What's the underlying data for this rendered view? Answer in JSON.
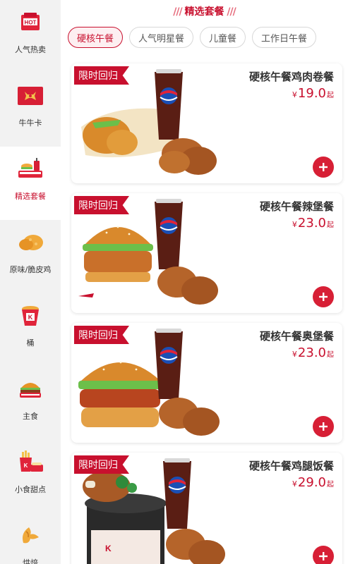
{
  "sidebar": {
    "items": [
      {
        "label": "人气热卖",
        "icon": "hot-box-icon"
      },
      {
        "label": "牛牛卡",
        "icon": "bull-card-icon"
      },
      {
        "label": "精选套餐",
        "icon": "combo-meal-icon"
      },
      {
        "label": "原味/脆皮鸡",
        "icon": "fried-chicken-icon"
      },
      {
        "label": "桶",
        "icon": "kfc-bucket-icon"
      },
      {
        "label": "主食",
        "icon": "burger-icon"
      },
      {
        "label": "小食甜点",
        "icon": "snack-fries-icon"
      },
      {
        "label": "烘焙",
        "icon": "croissant-icon"
      }
    ],
    "active_index": 2
  },
  "main": {
    "section_title": "精选套餐",
    "tabs": [
      {
        "label": "硬核午餐",
        "active": true
      },
      {
        "label": "人气明星餐",
        "active": false
      },
      {
        "label": "儿童餐",
        "active": false
      },
      {
        "label": "工作日午餐",
        "active": false
      }
    ],
    "products": [
      {
        "tag": "限时回归",
        "name": "硬核午餐鸡肉卷餐",
        "currency": "¥",
        "price": "19.0",
        "suffix": "起",
        "image": "wrap-wings-pepsi"
      },
      {
        "tag": "限时回归",
        "name": "硬核午餐辣堡餐",
        "currency": "¥",
        "price": "23.0",
        "suffix": "起",
        "image": "spicy-burger-wings-pepsi"
      },
      {
        "tag": "限时回归",
        "name": "硬核午餐奥堡餐",
        "currency": "¥",
        "price": "23.0",
        "suffix": "起",
        "image": "orleans-burger-wings-pepsi"
      },
      {
        "tag": "限时回归",
        "name": "硬核午餐鸡腿饭餐",
        "currency": "¥",
        "price": "29.0",
        "suffix": "起",
        "image": "drumstick-rice-wings-pepsi"
      }
    ]
  },
  "colors": {
    "brand_red": "#c8102e",
    "add_button": "#d71f35",
    "tab_active_bg": "#fdeff1"
  }
}
